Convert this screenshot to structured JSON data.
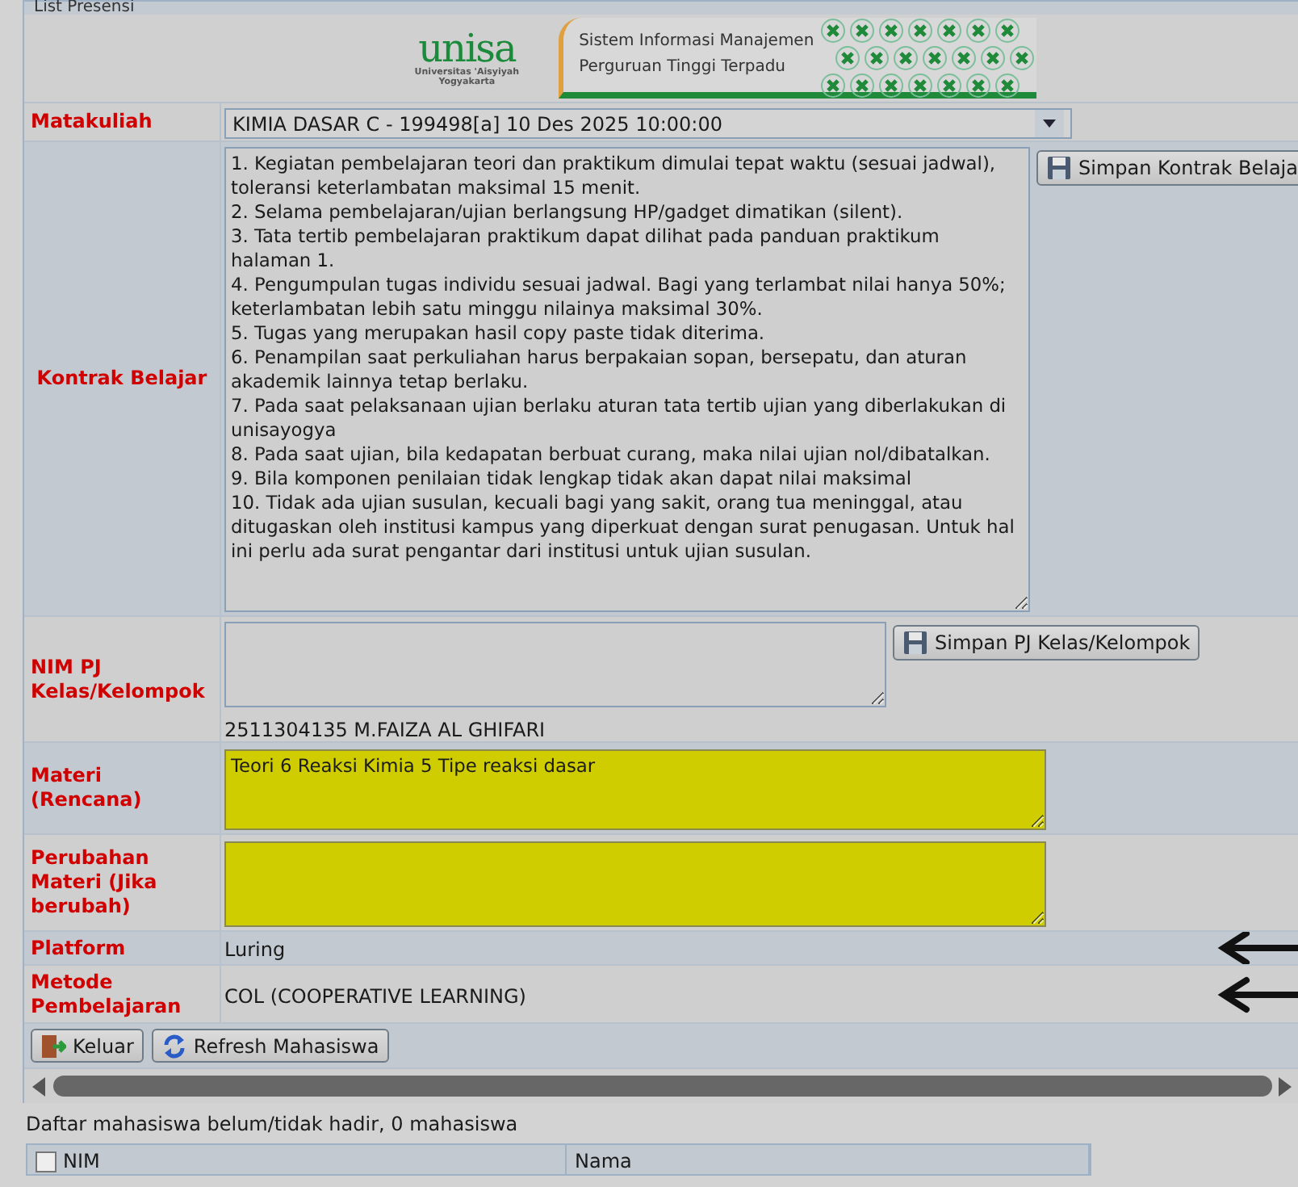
{
  "panel": {
    "title": "List Presensi"
  },
  "logo": {
    "wordmark": "unisa",
    "subtitle": [
      "Universitas 'Aisyiyah",
      "Yogyakarta"
    ],
    "banner_lines": [
      "Sistem Informasi Manajemen",
      "Perguruan Tinggi Terpadu"
    ]
  },
  "form": [
    {
      "kind": "select",
      "label": "Matakuliah",
      "value": "KIMIA DASAR C - 199498[a] 10 Des 2025 10:00:00"
    },
    {
      "kind": "textarea",
      "label": "Kontrak Belajar",
      "value": "1. Kegiatan pembelajaran teori dan praktikum dimulai tepat waktu (sesuai jadwal), toleransi keterlambatan maksimal 15 menit.\n2. Selama pembelajaran/ujian berlangsung HP/gadget dimatikan (silent).\n3. Tata tertib pembelajaran praktikum dapat dilihat pada panduan praktikum halaman 1.\n4. Pengumpulan tugas individu sesuai jadwal. Bagi yang terlambat nilai hanya 50%; keterlambatan lebih satu minggu nilainya maksimal 30%.\n5. Tugas yang merupakan hasil copy paste tidak diterima.\n6. Penampilan saat perkuliahan harus berpakaian sopan, bersepatu, dan aturan akademik lainnya tetap berlaku.\n7. Pada saat pelaksanaan ujian berlaku aturan tata tertib ujian yang diberlakukan di unisayogya\n8. Pada saat ujian, bila kedapatan berbuat curang, maka nilai ujian nol/dibatalkan.\n9. Bila komponen penilaian tidak lengkap tidak akan dapat nilai maksimal\n10. Tidak ada ujian susulan, kecuali bagi yang sakit, orang tua meninggal, atau ditugaskan oleh institusi kampus yang diperkuat dengan surat penugasan. Untuk hal ini perlu ada surat pengantar dari institusi untuk ujian susulan.",
      "button": "Simpan Kontrak Belaja",
      "highlight": false,
      "marked": false
    },
    {
      "kind": "textarea",
      "label": "NIM PJ Kelas/Kelompok",
      "button": "Simpan PJ Kelas/Kelompok",
      "note": "2511304135 M.FAIZA AL GHIFARI",
      "highlight": false,
      "marked": false
    },
    {
      "kind": "textarea",
      "label": "Materi (Rencana)",
      "value": "Teori 6 Reaksi Kimia 5 Tipe reaksi dasar",
      "highlight": true,
      "marked": false
    },
    {
      "kind": "textarea",
      "label": "Perubahan Materi (Jika berubah)",
      "highlight": true,
      "marked": false
    },
    {
      "kind": "text",
      "label": "Platform",
      "value": "Luring",
      "marked": true
    },
    {
      "kind": "text",
      "label": "Metode Pembelajaran",
      "value": "COL (COOPERATIVE LEARNING)",
      "marked": true
    }
  ],
  "buttons": [
    {
      "label": "Keluar"
    },
    {
      "label": "Refresh Mahasiswa"
    }
  ],
  "absent_summary": "Daftar mahasiswa belum/tidak hadir, 0 mahasiswa",
  "table": {
    "select_all": {
      "checked": false
    },
    "columns": [
      "NIM",
      "Nama"
    ]
  }
}
